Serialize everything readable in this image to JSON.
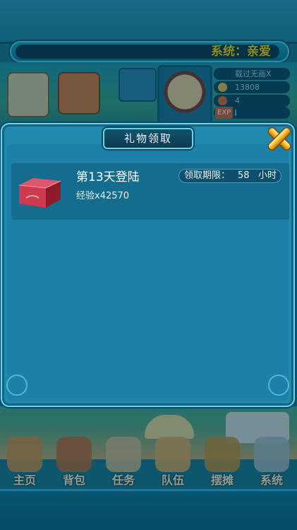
{
  "system_ticker": {
    "text": "系统：亲爱"
  },
  "player": {
    "name": "载过无画X",
    "gold": "13808",
    "level": "4",
    "exp_label": "EXP",
    "exp_progress": 0.02
  },
  "bottom_nav": {
    "items": [
      {
        "label": "主页",
        "icon": "pagoda-icon"
      },
      {
        "label": "背包",
        "icon": "bag-icon"
      },
      {
        "label": "任务",
        "icon": "scroll-icon"
      },
      {
        "label": "队伍",
        "icon": "team-icon"
      },
      {
        "label": "摆摊",
        "icon": "stall-icon"
      },
      {
        "label": "系统",
        "icon": "gear-icon"
      }
    ]
  },
  "gift_dialog": {
    "title": "礼物领取",
    "items": [
      {
        "name": "第13天登陆",
        "reward": "经验x42570",
        "deadline_label": "领取期限：",
        "deadline_value": "58",
        "deadline_unit": "小时"
      }
    ]
  },
  "colors": {
    "panel": "#2189ae",
    "panel_border": "#62d7f0",
    "ticker_text": "#ffd400",
    "close_button": "#f2b21b"
  }
}
